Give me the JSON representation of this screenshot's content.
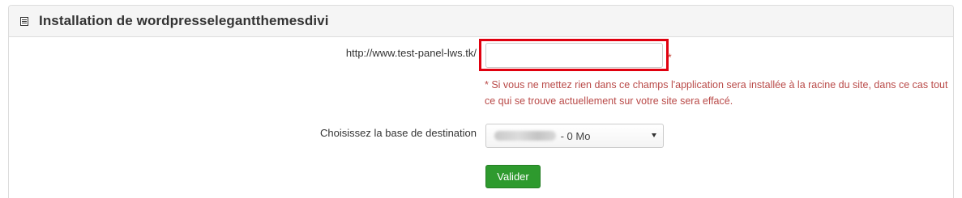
{
  "panel": {
    "title": "Installation de wordpresselegantthemesdivi",
    "icon": "list-icon"
  },
  "form": {
    "path": {
      "label": "http://www.test-panel-lws.tk/",
      "value": "",
      "required_mark": "*",
      "help_text": "* Si vous ne mettez rien dans ce champs l'application sera installée à la racine du site, dans ce cas tout ce qui se trouve actuellement sur votre site sera effacé."
    },
    "database": {
      "label": "Choisissez la base de destination",
      "selected_suffix": " - 0 Mo"
    },
    "submit_label": "Valider"
  },
  "colors": {
    "highlight": "#e0000f",
    "help_text": "#b94a48",
    "submit_bg": "#2e9a2e"
  }
}
